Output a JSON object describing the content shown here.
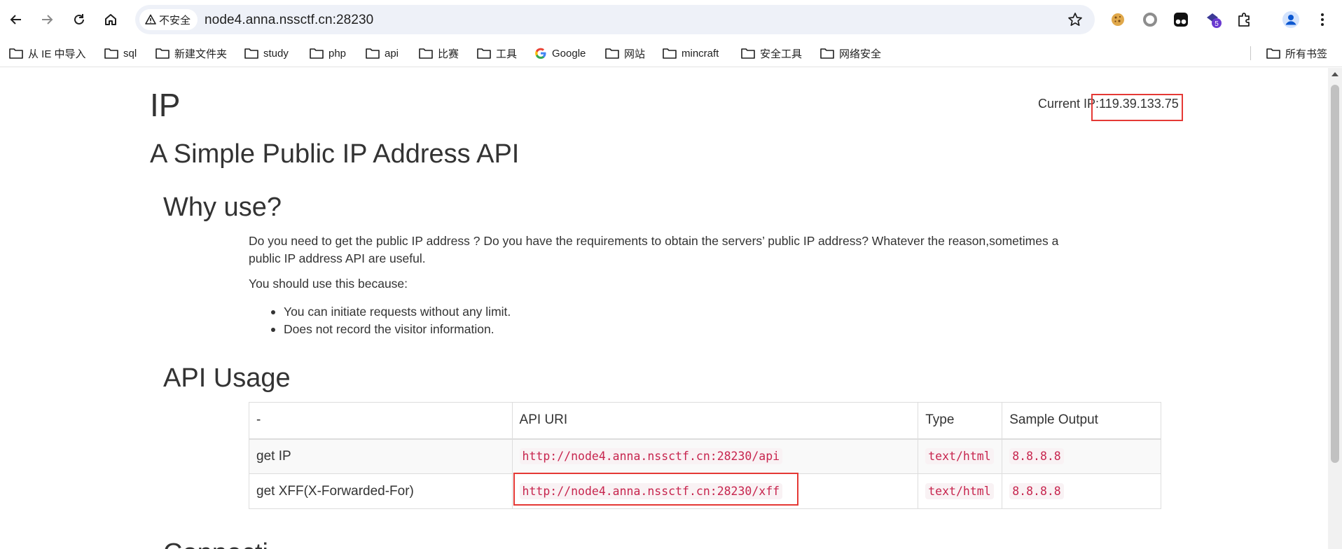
{
  "browser": {
    "security_label": "不安全",
    "url": "node4.anna.nssctf.cn:28230",
    "extension_badge": "5",
    "bookmarks": [
      {
        "label": "从 IE 中导入",
        "icon": "folder-icon"
      },
      {
        "label": "sql",
        "icon": "folder-icon"
      },
      {
        "label": "新建文件夹",
        "icon": "folder-icon"
      },
      {
        "label": "study",
        "icon": "folder-icon"
      },
      {
        "label": "php",
        "icon": "folder-icon"
      },
      {
        "label": "api",
        "icon": "folder-icon"
      },
      {
        "label": "比赛",
        "icon": "folder-icon"
      },
      {
        "label": "工具",
        "icon": "folder-icon"
      },
      {
        "label": "Google",
        "icon": "google-icon"
      },
      {
        "label": "网站",
        "icon": "folder-icon"
      },
      {
        "label": "mincraft",
        "icon": "folder-icon"
      },
      {
        "label": "安全工具",
        "icon": "folder-icon"
      },
      {
        "label": "网络安全",
        "icon": "folder-icon"
      }
    ],
    "all_bookmarks_label": "所有书签"
  },
  "page": {
    "title": "IP",
    "current_ip_label": "Current IP:",
    "current_ip_value": "119.39.133.75",
    "subtitle": "A Simple Public IP Address API",
    "why_heading": "Why use?",
    "why_text": "Do you need to get the public IP address ? Do you have the requirements to obtain the servers’ public IP address? Whatever the reason,sometimes a public IP address API are useful.",
    "should_use": "You should use this because:",
    "reasons": [
      "You can initiate requests without any limit.",
      "Does not record the visitor information."
    ],
    "api_heading": "API Usage",
    "table": {
      "headers": [
        "-",
        "API URI",
        "Type",
        "Sample Output"
      ],
      "rows": [
        {
          "name": "get IP",
          "uri": "http://node4.anna.nssctf.cn:28230/api",
          "type": "text/html",
          "sample": "8.8.8.8"
        },
        {
          "name": "get XFF(X-Forwarded-For)",
          "uri": "http://node4.anna.nssctf.cn:28230/xff",
          "type": "text/html",
          "sample": "8.8.8.8"
        }
      ]
    },
    "next_heading": "Connecti..."
  },
  "colors": {
    "highlight_box": "#e53935",
    "code_text": "#c7254e",
    "code_bg": "#f9f2f4"
  }
}
